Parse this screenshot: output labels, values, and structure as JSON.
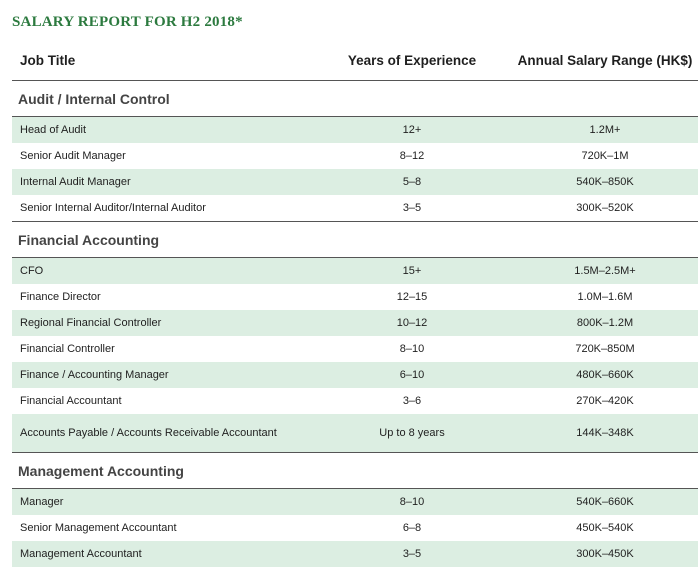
{
  "title": "SALARY REPORT FOR H2 2018*",
  "headers": {
    "job_title": "Job Title",
    "years": "Years of Experience",
    "salary": "Annual Salary Range (HK$)"
  },
  "sections": [
    {
      "name": "Audit / Internal Control",
      "rows": [
        {
          "title": "Head of Audit",
          "years": "12+",
          "salary": "1.2M+"
        },
        {
          "title": "Senior Audit Manager",
          "years": "8–12",
          "salary": "720K–1M"
        },
        {
          "title": "Internal Audit Manager",
          "years": "5–8",
          "salary": "540K–850K"
        },
        {
          "title": "Senior Internal Auditor/Internal Auditor",
          "years": "3–5",
          "salary": "300K–520K"
        }
      ]
    },
    {
      "name": "Financial Accounting",
      "rows": [
        {
          "title": "CFO",
          "years": "15+",
          "salary": "1.5M–2.5M+"
        },
        {
          "title": "Finance Director",
          "years": "12–15",
          "salary": "1.0M–1.6M"
        },
        {
          "title": "Regional Financial Controller",
          "years": "10–12",
          "salary": "800K–1.2M"
        },
        {
          "title": "Financial Controller",
          "years": "8–10",
          "salary": "720K–850M"
        },
        {
          "title": "Finance / Accounting Manager",
          "years": "6–10",
          "salary": "480K–660K"
        },
        {
          "title": "Financial Accountant",
          "years": "3–6",
          "salary": "270K–420K"
        },
        {
          "title": "Accounts Payable / Accounts Receivable Accountant",
          "years": "Up to 8 years",
          "salary": "144K–348K"
        }
      ]
    },
    {
      "name": "Management Accounting",
      "rows": [
        {
          "title": "Manager",
          "years": "8–10",
          "salary": "540K–660K"
        },
        {
          "title": "Senior Management Accountant",
          "years": "6–8",
          "salary": "450K–540K"
        },
        {
          "title": "Management Accountant",
          "years": "3–5",
          "salary": "300K–450K"
        }
      ]
    }
  ],
  "colors": {
    "title_green": "#2c7a3f",
    "row_shade": "#dceee2",
    "rule": "#555555"
  }
}
